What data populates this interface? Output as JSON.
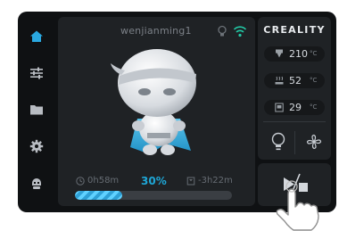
{
  "device": {
    "name": "wenjianming1"
  },
  "sidebar": {
    "items": [
      {
        "icon": "home-icon",
        "active": true
      },
      {
        "icon": "sliders-icon",
        "active": false
      },
      {
        "icon": "folder-icon",
        "active": false
      },
      {
        "icon": "gear-icon",
        "active": false
      },
      {
        "icon": "robot-icon",
        "active": false
      }
    ]
  },
  "status": {
    "elapsed": "0h58m",
    "progress_label": "30%",
    "progress": 0.3,
    "remaining": "-3h22m"
  },
  "brand": {
    "logo": "CREALITY"
  },
  "temps": {
    "nozzle": {
      "value": "210",
      "unit": "°C"
    },
    "bed": {
      "value": "52",
      "unit": "°C"
    },
    "chamber": {
      "value": "29",
      "unit": "°C"
    }
  },
  "colors": {
    "accent": "#1ea7d7",
    "panel": "#1f2225",
    "background": "#0f1113"
  }
}
